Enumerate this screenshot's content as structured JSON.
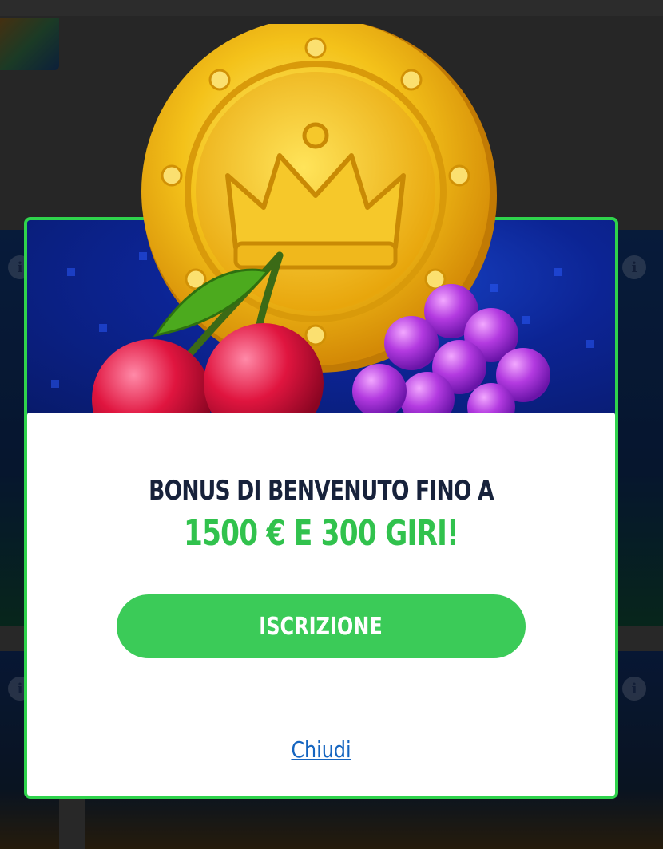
{
  "modal": {
    "headline": "BONUS DI BENVENUTO FINO A",
    "offer": "1500 € E 300 GIRI!",
    "signup_label": "ISCRIZIONE",
    "close_label": "Chiudi"
  },
  "background": {
    "info_icon_glyph": "i"
  },
  "colors": {
    "accent_green": "#3bcb58",
    "offer_green": "#31c24d",
    "headline_navy": "#17223b",
    "link_blue": "#1565c0",
    "frame_green": "#2fd34c"
  },
  "icons": [
    "info-icon",
    "gold-coin-crown-icon",
    "cherries-icon",
    "grapes-icon"
  ]
}
